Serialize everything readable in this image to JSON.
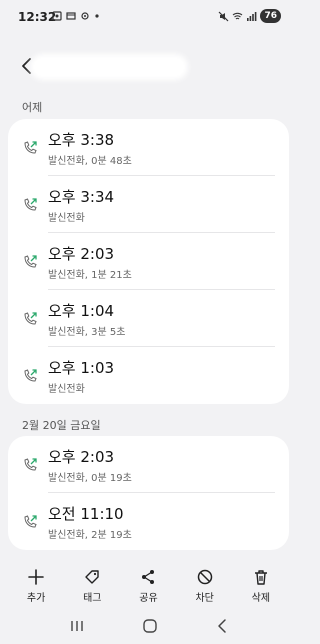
{
  "status": {
    "time": "12:32",
    "battery": "76"
  },
  "sections": [
    {
      "label": "어제",
      "calls": [
        {
          "time": "오후 3:38",
          "detail": "발신전화, 0분 48초"
        },
        {
          "time": "오후 3:34",
          "detail": "발신전화"
        },
        {
          "time": "오후 2:03",
          "detail": "발신전화, 1분 21초"
        },
        {
          "time": "오후 1:04",
          "detail": "발신전화, 3분 5초"
        },
        {
          "time": "오후 1:03",
          "detail": "발신전화"
        }
      ]
    },
    {
      "label": "2월 20일 금요일",
      "calls": [
        {
          "time": "오후 2:03",
          "detail": "발신전화, 0분 19초"
        },
        {
          "time": "오전 11:10",
          "detail": "발신전화, 2분 19초"
        }
      ]
    }
  ],
  "toolbar": {
    "add_label": "추가",
    "tag_label": "태그",
    "share_label": "공유",
    "block_label": "차단",
    "delete_label": "삭제"
  },
  "colors": {
    "outgoing_call_icon": "#2aa86b",
    "background": "#f2f2f4",
    "card": "#ffffff"
  }
}
